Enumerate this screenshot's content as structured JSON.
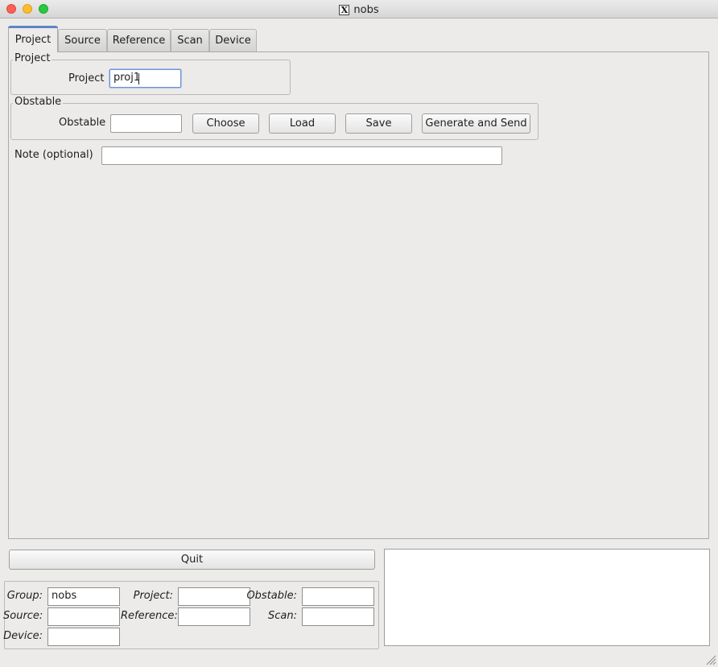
{
  "window": {
    "title": "nobs"
  },
  "tabs": [
    {
      "label": "Project"
    },
    {
      "label": "Source"
    },
    {
      "label": "Reference"
    },
    {
      "label": "Scan"
    },
    {
      "label": "Device"
    }
  ],
  "project_group": {
    "title": "Project",
    "label": "Project",
    "value": "proj1"
  },
  "obstable_group": {
    "title": "Obstable",
    "label": "Obstable",
    "value": "",
    "choose_label": "Choose",
    "load_label": "Load",
    "save_label": "Save",
    "generate_label": "Generate and Send"
  },
  "note": {
    "label": "Note (optional)",
    "value": ""
  },
  "quit_label": "Quit",
  "status": {
    "group_label": "Group:",
    "group_value": "nobs",
    "project_label": "Project:",
    "project_value": "",
    "obstable_label": "Obstable:",
    "obstable_value": "",
    "source_label": "Source:",
    "source_value": "",
    "reference_label": "Reference:",
    "reference_value": "",
    "scan_label": "Scan:",
    "scan_value": "",
    "device_label": "Device:",
    "device_value": ""
  },
  "log": {
    "text": ""
  }
}
